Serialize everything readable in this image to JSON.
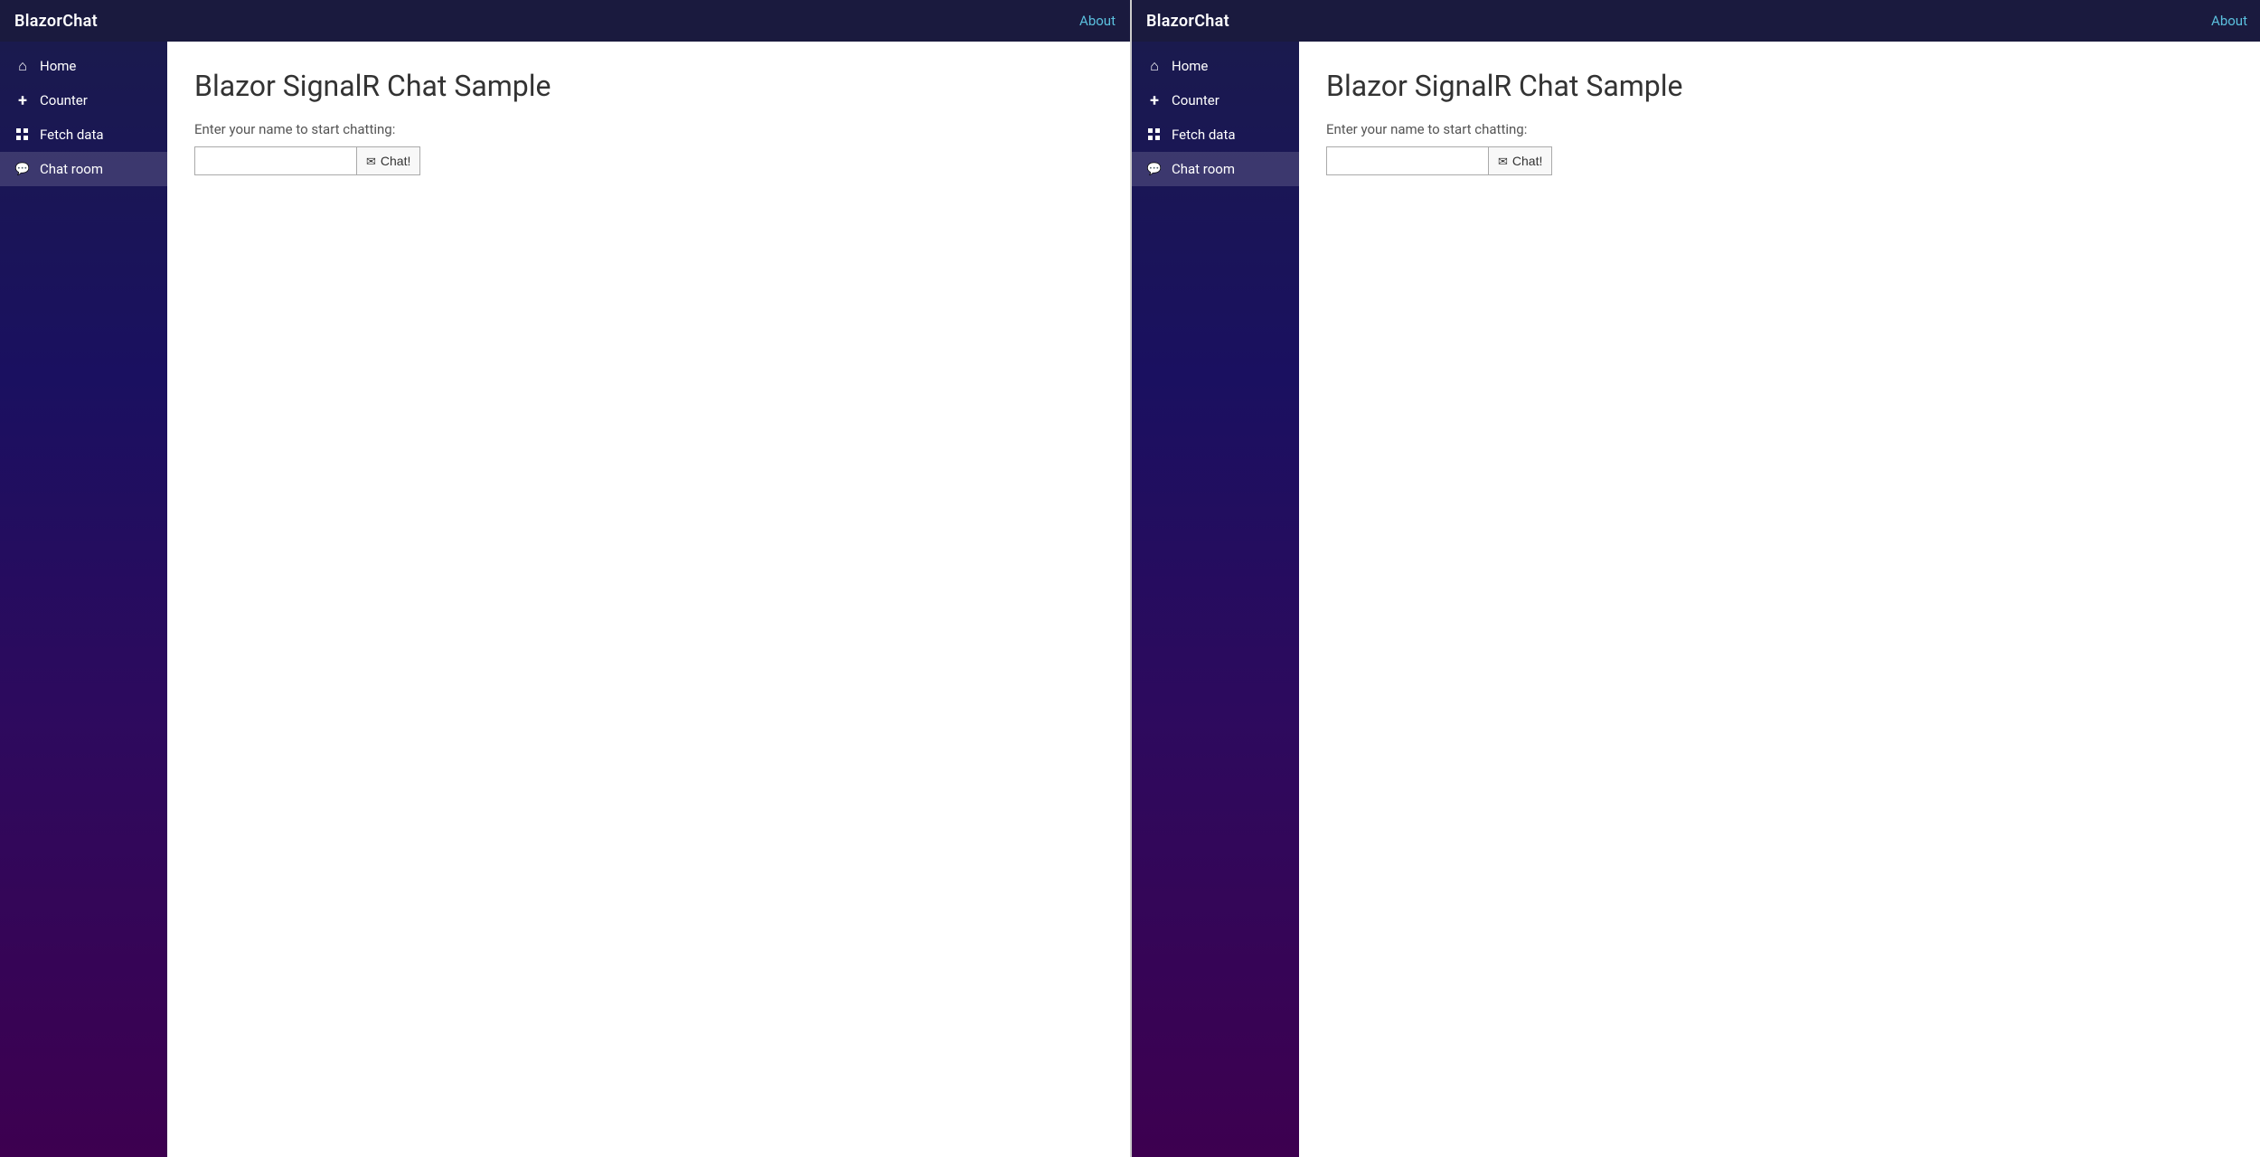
{
  "panel1": {
    "navbar": {
      "brand": "BlazorChat",
      "about_label": "About"
    },
    "sidebar": {
      "items": [
        {
          "id": "home",
          "label": "Home",
          "icon": "home-icon",
          "active": false
        },
        {
          "id": "counter",
          "label": "Counter",
          "icon": "plus-icon",
          "active": false
        },
        {
          "id": "fetch-data",
          "label": "Fetch data",
          "icon": "grid-icon",
          "active": false
        },
        {
          "id": "chat-room",
          "label": "Chat room",
          "icon": "chat-icon",
          "active": true
        }
      ]
    },
    "main": {
      "title": "Blazor SignalR Chat Sample",
      "prompt": "Enter your name to start chatting:",
      "name_placeholder": "",
      "chat_button_label": "Chat!"
    }
  },
  "panel2": {
    "navbar": {
      "brand": "BlazorChat",
      "about_label": "About"
    },
    "sidebar": {
      "items": [
        {
          "id": "home",
          "label": "Home",
          "icon": "home-icon",
          "active": false
        },
        {
          "id": "counter",
          "label": "Counter",
          "icon": "plus-icon",
          "active": false
        },
        {
          "id": "fetch-data",
          "label": "Fetch data",
          "icon": "grid-icon",
          "active": false
        },
        {
          "id": "chat-room",
          "label": "Chat room",
          "icon": "chat-icon",
          "active": true
        }
      ]
    },
    "main": {
      "title": "Blazor SignalR Chat Sample",
      "prompt": "Enter your name to start chatting:",
      "name_placeholder": "",
      "chat_button_label": "Chat!"
    }
  }
}
